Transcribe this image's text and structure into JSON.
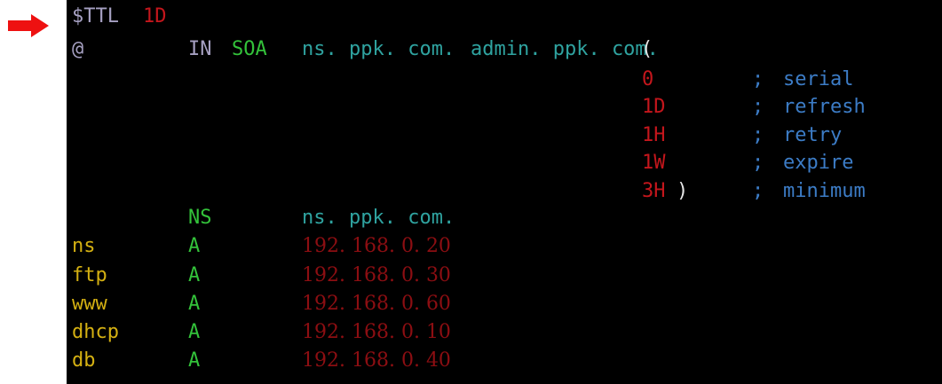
{
  "arrow": {
    "icon": "right-arrow-icon",
    "color": "#ee1111"
  },
  "ttl": {
    "keyword": "$TTL",
    "value": "1D"
  },
  "soa": {
    "origin": "@",
    "class": "IN",
    "type": "SOA",
    "primary_ns": "ns. ppk. com.",
    "admin": "admin. ppk. com.",
    "open_paren": "(",
    "close_paren": ")",
    "fields": [
      {
        "value": "0",
        "comment_sep": ";",
        "comment": "serial"
      },
      {
        "value": "1D",
        "comment_sep": ";",
        "comment": "refresh"
      },
      {
        "value": "1H",
        "comment_sep": ";",
        "comment": "retry"
      },
      {
        "value": "1W",
        "comment_sep": ";",
        "comment": "expire"
      },
      {
        "value": "3H",
        "comment_sep": ";",
        "comment": "minimum"
      }
    ]
  },
  "ns_record": {
    "type": "NS",
    "value": "ns. ppk. com."
  },
  "a_records": [
    {
      "name": "ns",
      "type": "A",
      "ip": "192. 168. 0. 20"
    },
    {
      "name": "ftp",
      "type": "A",
      "ip": "192. 168. 0. 30"
    },
    {
      "name": "www",
      "type": "A",
      "ip": "192. 168. 0. 60"
    },
    {
      "name": "dhcp",
      "type": "A",
      "ip": "192. 168. 0. 10"
    },
    {
      "name": "db",
      "type": "A",
      "ip": "192. 168. 0. 40"
    }
  ],
  "colors": {
    "background": "#000000",
    "directive": "#a6a0c2",
    "number": "#c4161c",
    "domain": "#2fa3a0",
    "record_type": "#33c23a",
    "hostname": "#d4b012",
    "comment": "#3c7cc6"
  }
}
